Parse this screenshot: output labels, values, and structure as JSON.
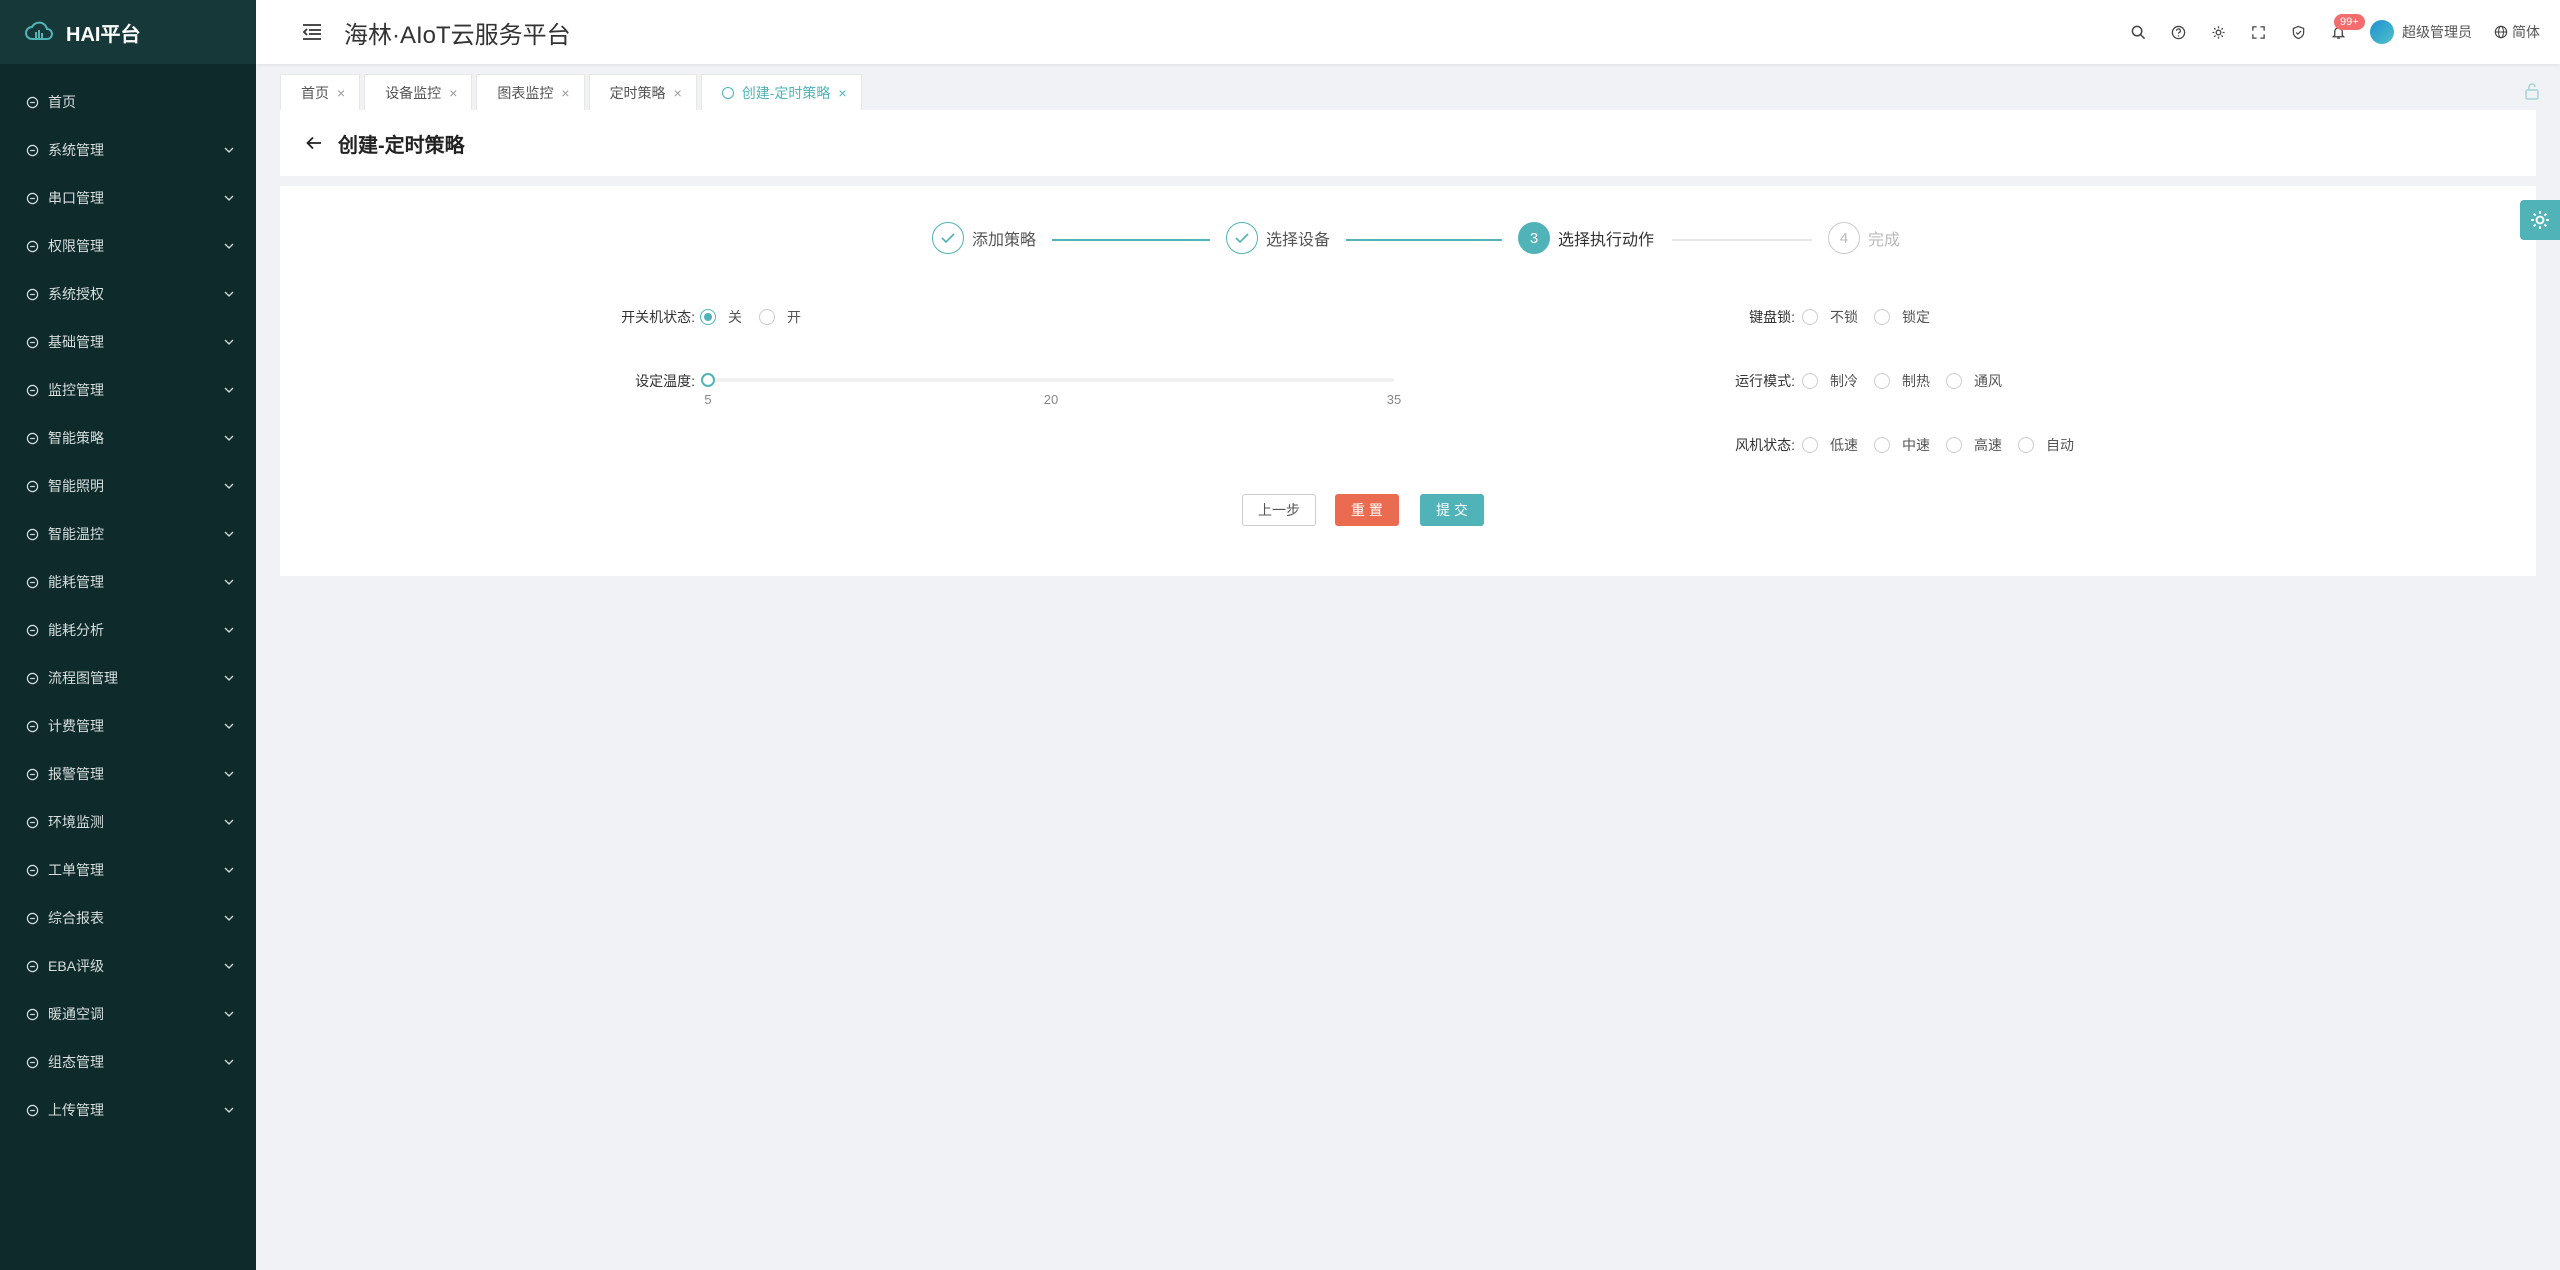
{
  "app": {
    "logo_text": "HAI平台",
    "title": "海林·AIoT云服务平台"
  },
  "sidebar": {
    "items": [
      {
        "label": "首页",
        "icon": "home-icon",
        "has_children": false
      },
      {
        "label": "系统管理",
        "icon": "monitor-icon",
        "has_children": true
      },
      {
        "label": "串口管理",
        "icon": "sliders-icon",
        "has_children": true
      },
      {
        "label": "权限管理",
        "icon": "shield-icon",
        "has_children": true
      },
      {
        "label": "系统授权",
        "icon": "license-icon",
        "has_children": true
      },
      {
        "label": "基础管理",
        "icon": "database-icon",
        "has_children": true
      },
      {
        "label": "监控管理",
        "icon": "monitor-screen-icon",
        "has_children": true
      },
      {
        "label": "智能策略",
        "icon": "bulb-icon",
        "has_children": true
      },
      {
        "label": "智能照明",
        "icon": "light-icon",
        "has_children": true
      },
      {
        "label": "智能温控",
        "icon": "thermo-icon",
        "has_children": true
      },
      {
        "label": "能耗管理",
        "icon": "sliders-icon",
        "has_children": true
      },
      {
        "label": "能耗分析",
        "icon": "bar-chart-icon",
        "has_children": true
      },
      {
        "label": "流程图管理",
        "icon": "flow-icon",
        "has_children": true
      },
      {
        "label": "计费管理",
        "icon": "billing-icon",
        "has_children": true
      },
      {
        "label": "报警管理",
        "icon": "alarm-icon",
        "has_children": true
      },
      {
        "label": "环境监测",
        "icon": "leaf-icon",
        "has_children": true
      },
      {
        "label": "工单管理",
        "icon": "layers-icon",
        "has_children": true
      },
      {
        "label": "综合报表",
        "icon": "report-icon",
        "has_children": true
      },
      {
        "label": "EBA评级",
        "icon": "rating-icon",
        "has_children": true
      },
      {
        "label": "暖通空调",
        "icon": "hvac-icon",
        "has_children": true
      },
      {
        "label": "组态管理",
        "icon": "config-icon",
        "has_children": true
      },
      {
        "label": "上传管理",
        "icon": "upload-icon",
        "has_children": true
      }
    ]
  },
  "header": {
    "notification_badge": "99+",
    "user_name": "超级管理员",
    "language": "简体",
    "icons": [
      "search-icon",
      "help-icon",
      "gear-icon",
      "fullscreen-icon",
      "shield-check-icon",
      "bell-icon"
    ]
  },
  "tabs": [
    {
      "label": "首页",
      "active": false
    },
    {
      "label": "设备监控",
      "active": false
    },
    {
      "label": "图表监控",
      "active": false
    },
    {
      "label": "定时策略",
      "active": false
    },
    {
      "label": "创建-定时策略",
      "active": true
    }
  ],
  "page": {
    "title": "创建-定时策略"
  },
  "steps": [
    {
      "label": "添加策略",
      "number": "1",
      "status": "done"
    },
    {
      "label": "选择设备",
      "number": "2",
      "status": "done"
    },
    {
      "label": "选择执行动作",
      "number": "3",
      "status": "current"
    },
    {
      "label": "完成",
      "number": "4",
      "status": "pending"
    }
  ],
  "form": {
    "power": {
      "label": "开关机状态:",
      "options": [
        "关",
        "开"
      ],
      "selected": "关"
    },
    "temperature": {
      "label": "设定温度:",
      "min": 5,
      "max": 35,
      "value": 5,
      "marks": [
        "5",
        "20",
        "35"
      ]
    },
    "keyboard_lock": {
      "label": "键盘锁:",
      "options": [
        "不锁",
        "锁定"
      ],
      "selected": null
    },
    "run_mode": {
      "label": "运行模式:",
      "options": [
        "制冷",
        "制热",
        "通风"
      ],
      "selected": null
    },
    "fan_state": {
      "label": "风机状态:",
      "options": [
        "低速",
        "中速",
        "高速",
        "自动"
      ],
      "selected": null
    }
  },
  "buttons": {
    "prev": "上一步",
    "reset": "重 置",
    "submit": "提 交"
  },
  "colors": {
    "sidebar_bg": "#0f2a2a",
    "accent": "#4fb3b8",
    "danger": "#ea6b4f",
    "badge": "#f56c6c"
  }
}
